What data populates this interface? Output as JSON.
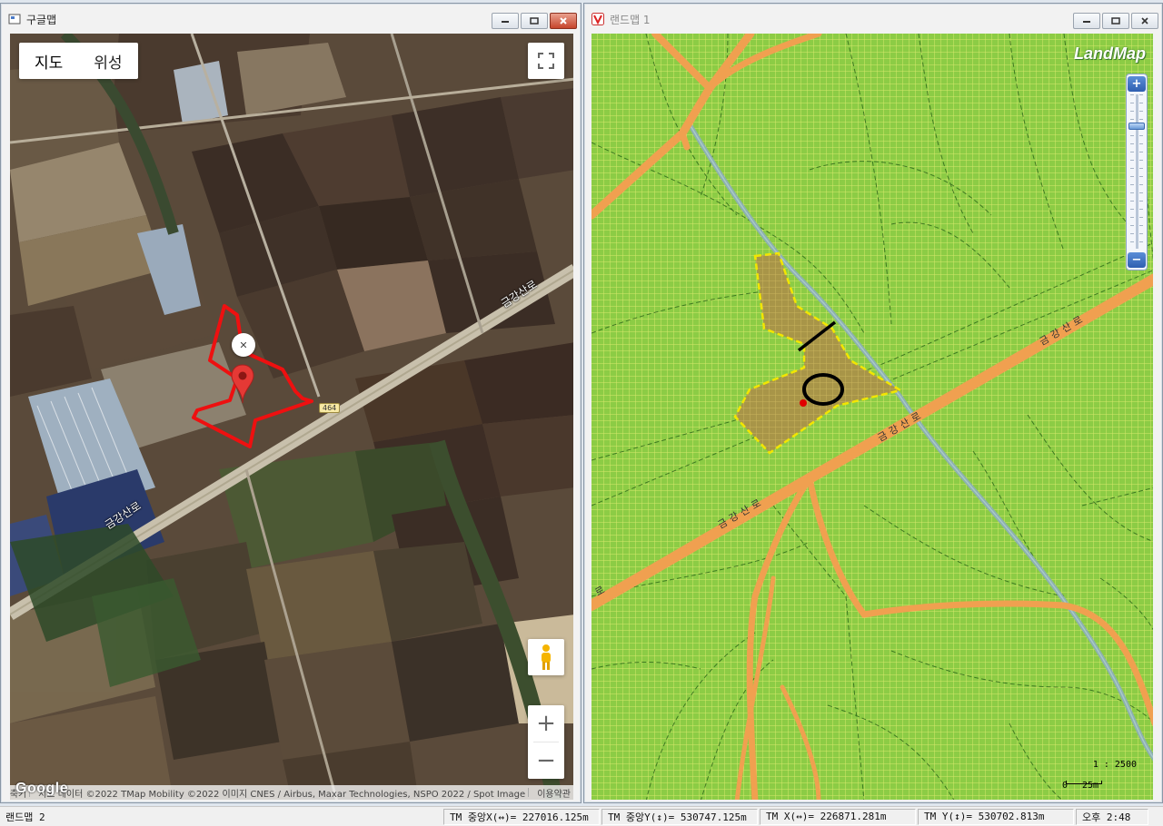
{
  "google_window": {
    "title": "구글맵",
    "map_type_buttons": [
      "지도",
      "위성"
    ],
    "road_label_upper": "금강산로",
    "road_label_lower": "금강산로",
    "route_shield": "464",
    "marker_close": "✕",
    "zoom_in": "+",
    "zoom_out": "−",
    "logo": "Google",
    "attribution": {
      "shortcuts": "단축키",
      "map_data": "지도 데이터 ©2022 TMap Mobility ©2022 이미지 CNES / Airbus, Maxar Technologies, NSPO 2022 / Spot Image",
      "terms": "이용약관"
    },
    "icons": [
      "fullscreen-icon",
      "pegman-icon",
      "map-pin-icon"
    ]
  },
  "landmap_window": {
    "title": "랜드맵 1",
    "logo": "LandMap",
    "road_labels": [
      "금강산로",
      "금강산로",
      "금강산로",
      "로"
    ],
    "zoom_plus": "+",
    "zoom_minus": "−",
    "scale_ratio": "1 : 2500",
    "scale_zero": "0",
    "scale_distance": "25m",
    "colors": {
      "land": "#8ccc45",
      "road": "#f0a050",
      "parcel": "#a89548",
      "parcel_border": "#f2e600",
      "stream": "#8db0b0"
    }
  },
  "statusbar": {
    "window_name": "랜드맵 2",
    "tm_center_x": "TM 중앙X(↔)= 227016.125m",
    "tm_center_y": "TM 중앙Y(↕)= 530747.125m",
    "tm_x": "TM X(↔)= 226871.281m",
    "tm_y": "TM Y(↕)= 530702.813m",
    "clock": "오후 2:48"
  }
}
